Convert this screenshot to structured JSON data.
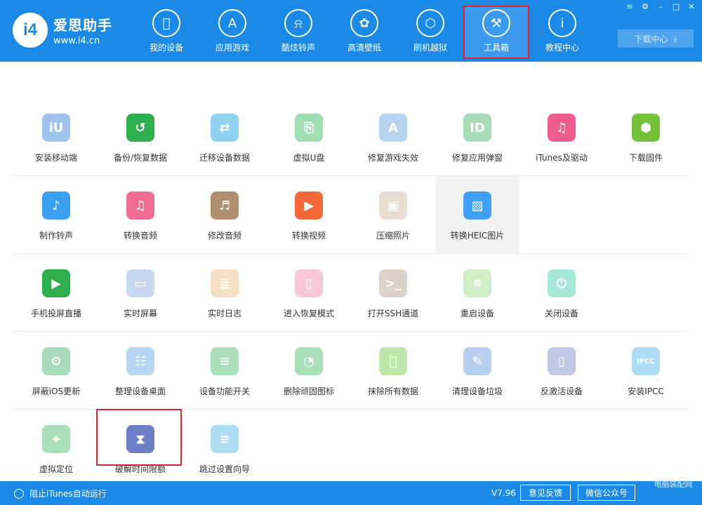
{
  "brand": {
    "name": "爱思助手",
    "url": "www.i4.cn",
    "mark": "i4"
  },
  "window_controls": [
    "≡",
    "⚙",
    "–",
    "□",
    "✕"
  ],
  "nav": [
    {
      "label": "我的设备",
      "icon": "apple-icon"
    },
    {
      "label": "应用游戏",
      "icon": "app-store-icon"
    },
    {
      "label": "酷炫铃声",
      "icon": "bell-icon"
    },
    {
      "label": "高清壁纸",
      "icon": "flower-icon"
    },
    {
      "label": "刷机越狱",
      "icon": "dropbox-icon"
    },
    {
      "label": "工具箱",
      "icon": "tools-icon",
      "active": true
    },
    {
      "label": "教程中心",
      "icon": "info-icon"
    }
  ],
  "download_center": "下载中心",
  "tools": [
    [
      {
        "label": "安装移动端",
        "color": "#9ec3ee",
        "glyph": "iU"
      },
      {
        "label": "备份/恢复数据",
        "color": "#2fae4e",
        "glyph": "↺"
      },
      {
        "label": "迁移设备数据",
        "color": "#8ed2f0",
        "glyph": "⇄"
      },
      {
        "label": "虚拟U盘",
        "color": "#9edeb1",
        "glyph": "⎘"
      },
      {
        "label": "修复游戏失效",
        "color": "#b7d3ef",
        "glyph": "A"
      },
      {
        "label": "修复应用弹窗",
        "color": "#a9dbb9",
        "glyph": "ID"
      },
      {
        "label": "iTunes及驱动",
        "color": "#ef5d8c",
        "glyph": "♫"
      },
      {
        "label": "下载固件",
        "color": "#74c23c",
        "glyph": "⬢"
      }
    ],
    [
      {
        "label": "制作铃声",
        "color": "#3b9ff0",
        "glyph": "♪"
      },
      {
        "label": "转换音频",
        "color": "#f06d91",
        "glyph": "♫"
      },
      {
        "label": "修改音频",
        "color": "#b08e6e",
        "glyph": "♬"
      },
      {
        "label": "转换视频",
        "color": "#f3693a",
        "glyph": "▶"
      },
      {
        "label": "压缩照片",
        "color": "#e8ddd0",
        "glyph": "▣"
      },
      {
        "label": "转换HEIC图片",
        "color": "#3f9ff2",
        "glyph": "▨",
        "hover": true
      }
    ],
    [
      {
        "label": "手机投屏直播",
        "color": "#2fae4e",
        "glyph": "▶"
      },
      {
        "label": "实时屏幕",
        "color": "#c8d8ee",
        "glyph": "▭"
      },
      {
        "label": "实时日志",
        "color": "#f7e0c8",
        "glyph": "≣"
      },
      {
        "label": "进入恢复模式",
        "color": "#f7c9d6",
        "glyph": "▯"
      },
      {
        "label": "打开SSH通道",
        "color": "#d9d3cc",
        "glyph": ">_"
      },
      {
        "label": "重启设备",
        "color": "#cfeec7",
        "glyph": "✵"
      },
      {
        "label": "关闭设备",
        "color": "#a8e8d6",
        "glyph": "⏻"
      }
    ],
    [
      {
        "label": "屏蔽iOS更新",
        "color": "#a8dbb8",
        "glyph": "⚙"
      },
      {
        "label": "整理设备桌面",
        "color": "#b8d6f3",
        "glyph": "☷"
      },
      {
        "label": "设备功能开关",
        "color": "#a9dfb9",
        "glyph": "≡"
      },
      {
        "label": "删除顽固图标",
        "color": "#a9dfb9",
        "glyph": "◔"
      },
      {
        "label": "抹除所有数据",
        "color": "#bfe7a9",
        "glyph": ""
      },
      {
        "label": "清理设备垃圾",
        "color": "#b8cff2",
        "glyph": "✎"
      },
      {
        "label": "反激活设备",
        "color": "#c1c8e8",
        "glyph": "▯"
      },
      {
        "label": "安装IPCC",
        "color": "#aedcf4",
        "glyph": "IPCC"
      }
    ],
    [
      {
        "label": "虚拟定位",
        "color": "#a9dfb9",
        "glyph": "⌖"
      },
      {
        "label": "破解时间限额",
        "color": "#6e7fc4",
        "glyph": "⧗"
      },
      {
        "label": "跳过设置向导",
        "color": "#aedcf4",
        "glyph": "≡"
      }
    ]
  ],
  "footer": {
    "itunes_toggle": "阻止iTunes自动运行",
    "version": "V7.96",
    "feedback": "意见反馈",
    "wechat": "微信公众号",
    "watermark": "电脑装配网"
  }
}
